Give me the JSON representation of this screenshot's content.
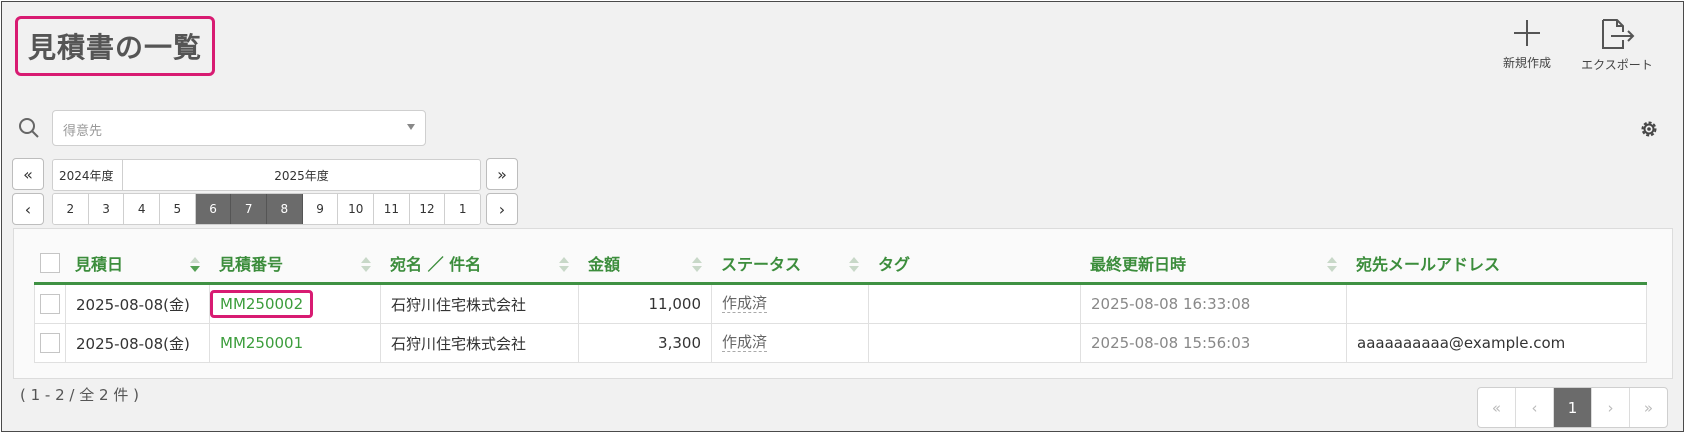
{
  "page": {
    "title": "見積書の一覧"
  },
  "toolbar": {
    "new_label": "新規作成",
    "export_label": "エクスポート"
  },
  "filter": {
    "customer_placeholder": "得意先"
  },
  "period": {
    "prev_year": "2024年度",
    "current_year": "2025年度",
    "months": [
      "2",
      "3",
      "4",
      "5",
      "6",
      "7",
      "8",
      "9",
      "10",
      "11",
      "12",
      "1"
    ],
    "selected_months": [
      "6",
      "7",
      "8"
    ]
  },
  "table": {
    "headers": [
      "見積日",
      "見積番号",
      "宛名 ／ 件名",
      "金額",
      "ステータス",
      "タグ",
      "最終更新日時",
      "宛先メールアドレス"
    ],
    "rows": [
      {
        "date": "2025-08-08(金)",
        "number": "MM250002",
        "addressee": "石狩川住宅株式会社",
        "amount": "11,000",
        "status": "作成済",
        "tag": "",
        "updated": "2025-08-08 16:33:08",
        "email": ""
      },
      {
        "date": "2025-08-08(金)",
        "number": "MM250001",
        "addressee": "石狩川住宅株式会社",
        "amount": "3,300",
        "status": "作成済",
        "tag": "",
        "updated": "2025-08-08 15:56:03",
        "email": "aaaaaaaaaa@example.com"
      }
    ]
  },
  "footer": {
    "count_text": "( 1 - 2 / 全 2 件 )"
  },
  "pagination": {
    "first": "«",
    "prev": "‹",
    "current": "1",
    "next": "›",
    "last": "»"
  },
  "nav": {
    "year_prev": "«",
    "year_next": "»",
    "month_prev": "‹",
    "month_next": "›"
  },
  "colors": {
    "accent_green": "#3c8d3c",
    "highlight": "#d81b72",
    "selected_month": "#6b6b6b"
  }
}
